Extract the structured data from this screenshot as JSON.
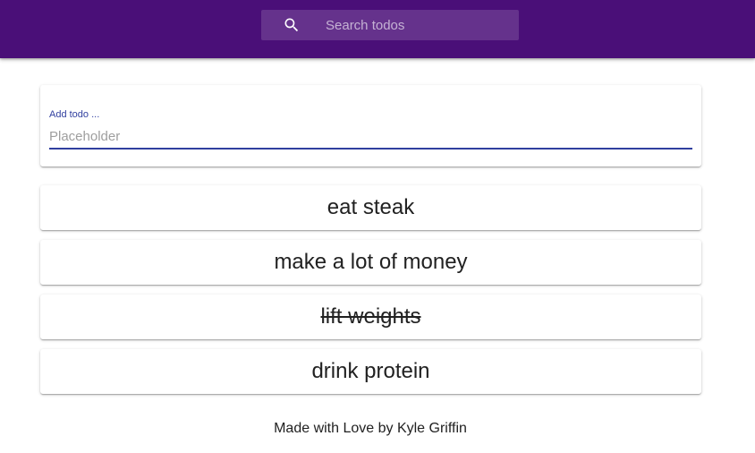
{
  "header": {
    "search_placeholder": "Search todos",
    "background_color": "#4a0f78",
    "search_icon": "search-icon"
  },
  "add_todo": {
    "label": "Add todo ...",
    "placeholder": "Placeholder",
    "value": "",
    "accent_color": "#303f9f"
  },
  "todos": [
    {
      "text": "eat steak",
      "completed": false
    },
    {
      "text": "make a lot of money",
      "completed": false
    },
    {
      "text": "lift weights",
      "completed": true
    },
    {
      "text": "drink protein",
      "completed": false
    }
  ],
  "footer": {
    "text": "Made with Love by Kyle Griffin"
  }
}
